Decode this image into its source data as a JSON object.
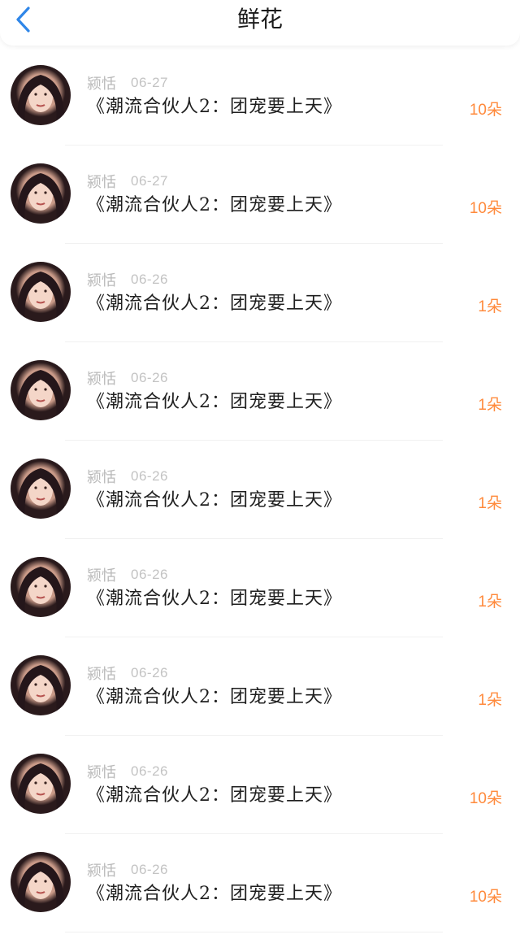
{
  "header": {
    "title": "鲜花",
    "back_icon": "chevron-left-icon"
  },
  "colors": {
    "accent_blue": "#2f86e8",
    "amount_orange": "#ff8a3c",
    "meta_gray": "#b9b9b9"
  },
  "items": [
    {
      "user": "颍恬",
      "date": "06-27",
      "title": "《潮流合伙人2：团宠要上天》",
      "amount": "10朵"
    },
    {
      "user": "颍恬",
      "date": "06-27",
      "title": "《潮流合伙人2：团宠要上天》",
      "amount": "10朵"
    },
    {
      "user": "颍恬",
      "date": "06-26",
      "title": "《潮流合伙人2：团宠要上天》",
      "amount": "1朵"
    },
    {
      "user": "颍恬",
      "date": "06-26",
      "title": "《潮流合伙人2：团宠要上天》",
      "amount": "1朵"
    },
    {
      "user": "颍恬",
      "date": "06-26",
      "title": "《潮流合伙人2：团宠要上天》",
      "amount": "1朵"
    },
    {
      "user": "颍恬",
      "date": "06-26",
      "title": "《潮流合伙人2：团宠要上天》",
      "amount": "1朵"
    },
    {
      "user": "颍恬",
      "date": "06-26",
      "title": "《潮流合伙人2：团宠要上天》",
      "amount": "1朵"
    },
    {
      "user": "颍恬",
      "date": "06-26",
      "title": "《潮流合伙人2：团宠要上天》",
      "amount": "10朵"
    },
    {
      "user": "颍恬",
      "date": "06-26",
      "title": "《潮流合伙人2：团宠要上天》",
      "amount": "10朵"
    }
  ]
}
